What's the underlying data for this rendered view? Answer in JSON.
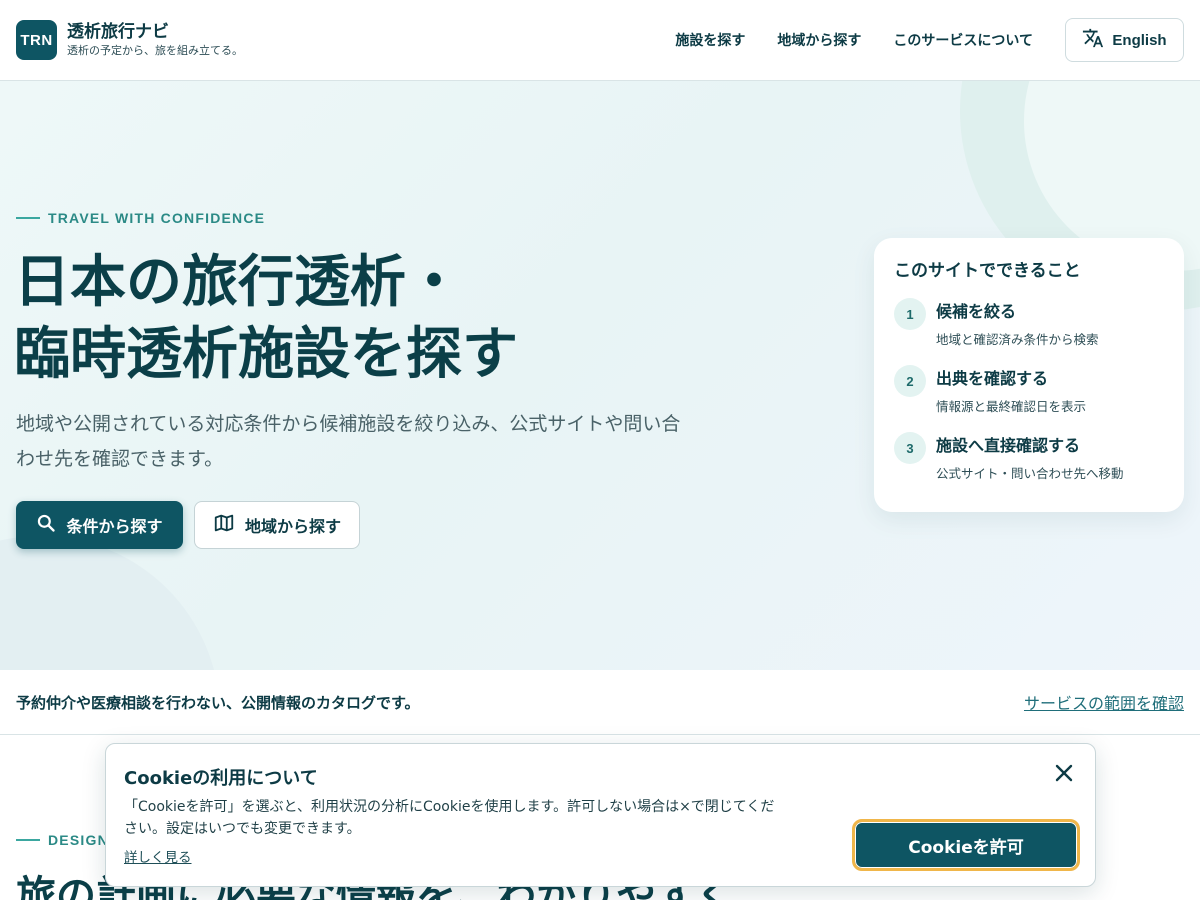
{
  "header": {
    "logo": "TRN",
    "brand_name": "透析旅行ナビ",
    "brand_tagline": "透析の予定から、旅を組み立てる。",
    "nav": [
      {
        "label": "施設を探す"
      },
      {
        "label": "地域から探す"
      },
      {
        "label": "このサービスについて"
      }
    ],
    "language_button": "English"
  },
  "hero": {
    "eyebrow": "TRAVEL WITH CONFIDENCE",
    "title_line1": "日本の旅行透析・",
    "title_line2": "臨時透析施設を探す",
    "subtitle": "地域や公開されている対応条件から候補施設を絞り込み、公式サイトや問い合わせ先を確認できます。",
    "primary_button": "条件から探す",
    "secondary_button": "地域から探す"
  },
  "card": {
    "title": "このサイトでできること",
    "steps": [
      {
        "num": "1",
        "head": "候補を絞る",
        "desc": "地域と確認済み条件から検索"
      },
      {
        "num": "2",
        "head": "出典を確認する",
        "desc": "情報源と最終確認日を表示"
      },
      {
        "num": "3",
        "head": "施設へ直接確認する",
        "desc": "公式サイト・問い合わせ先へ移動"
      }
    ]
  },
  "notice": {
    "text": "予約仲介や医療相談を行わない、公開情報のカタログです。",
    "link": "サービスの範囲を確認"
  },
  "design": {
    "eyebrow": "DESIGN",
    "title": "旅の計画に必要な情報を、わかりやすく"
  },
  "cookie": {
    "title": "Cookieの利用について",
    "body": "「Cookieを許可」を選ぶと、利用状況の分析にCookieを使用します。許可しない場合は×で閉じてください。設定はいつでも変更できます。",
    "more": "詳しく見る",
    "accept": "Cookieを許可"
  }
}
